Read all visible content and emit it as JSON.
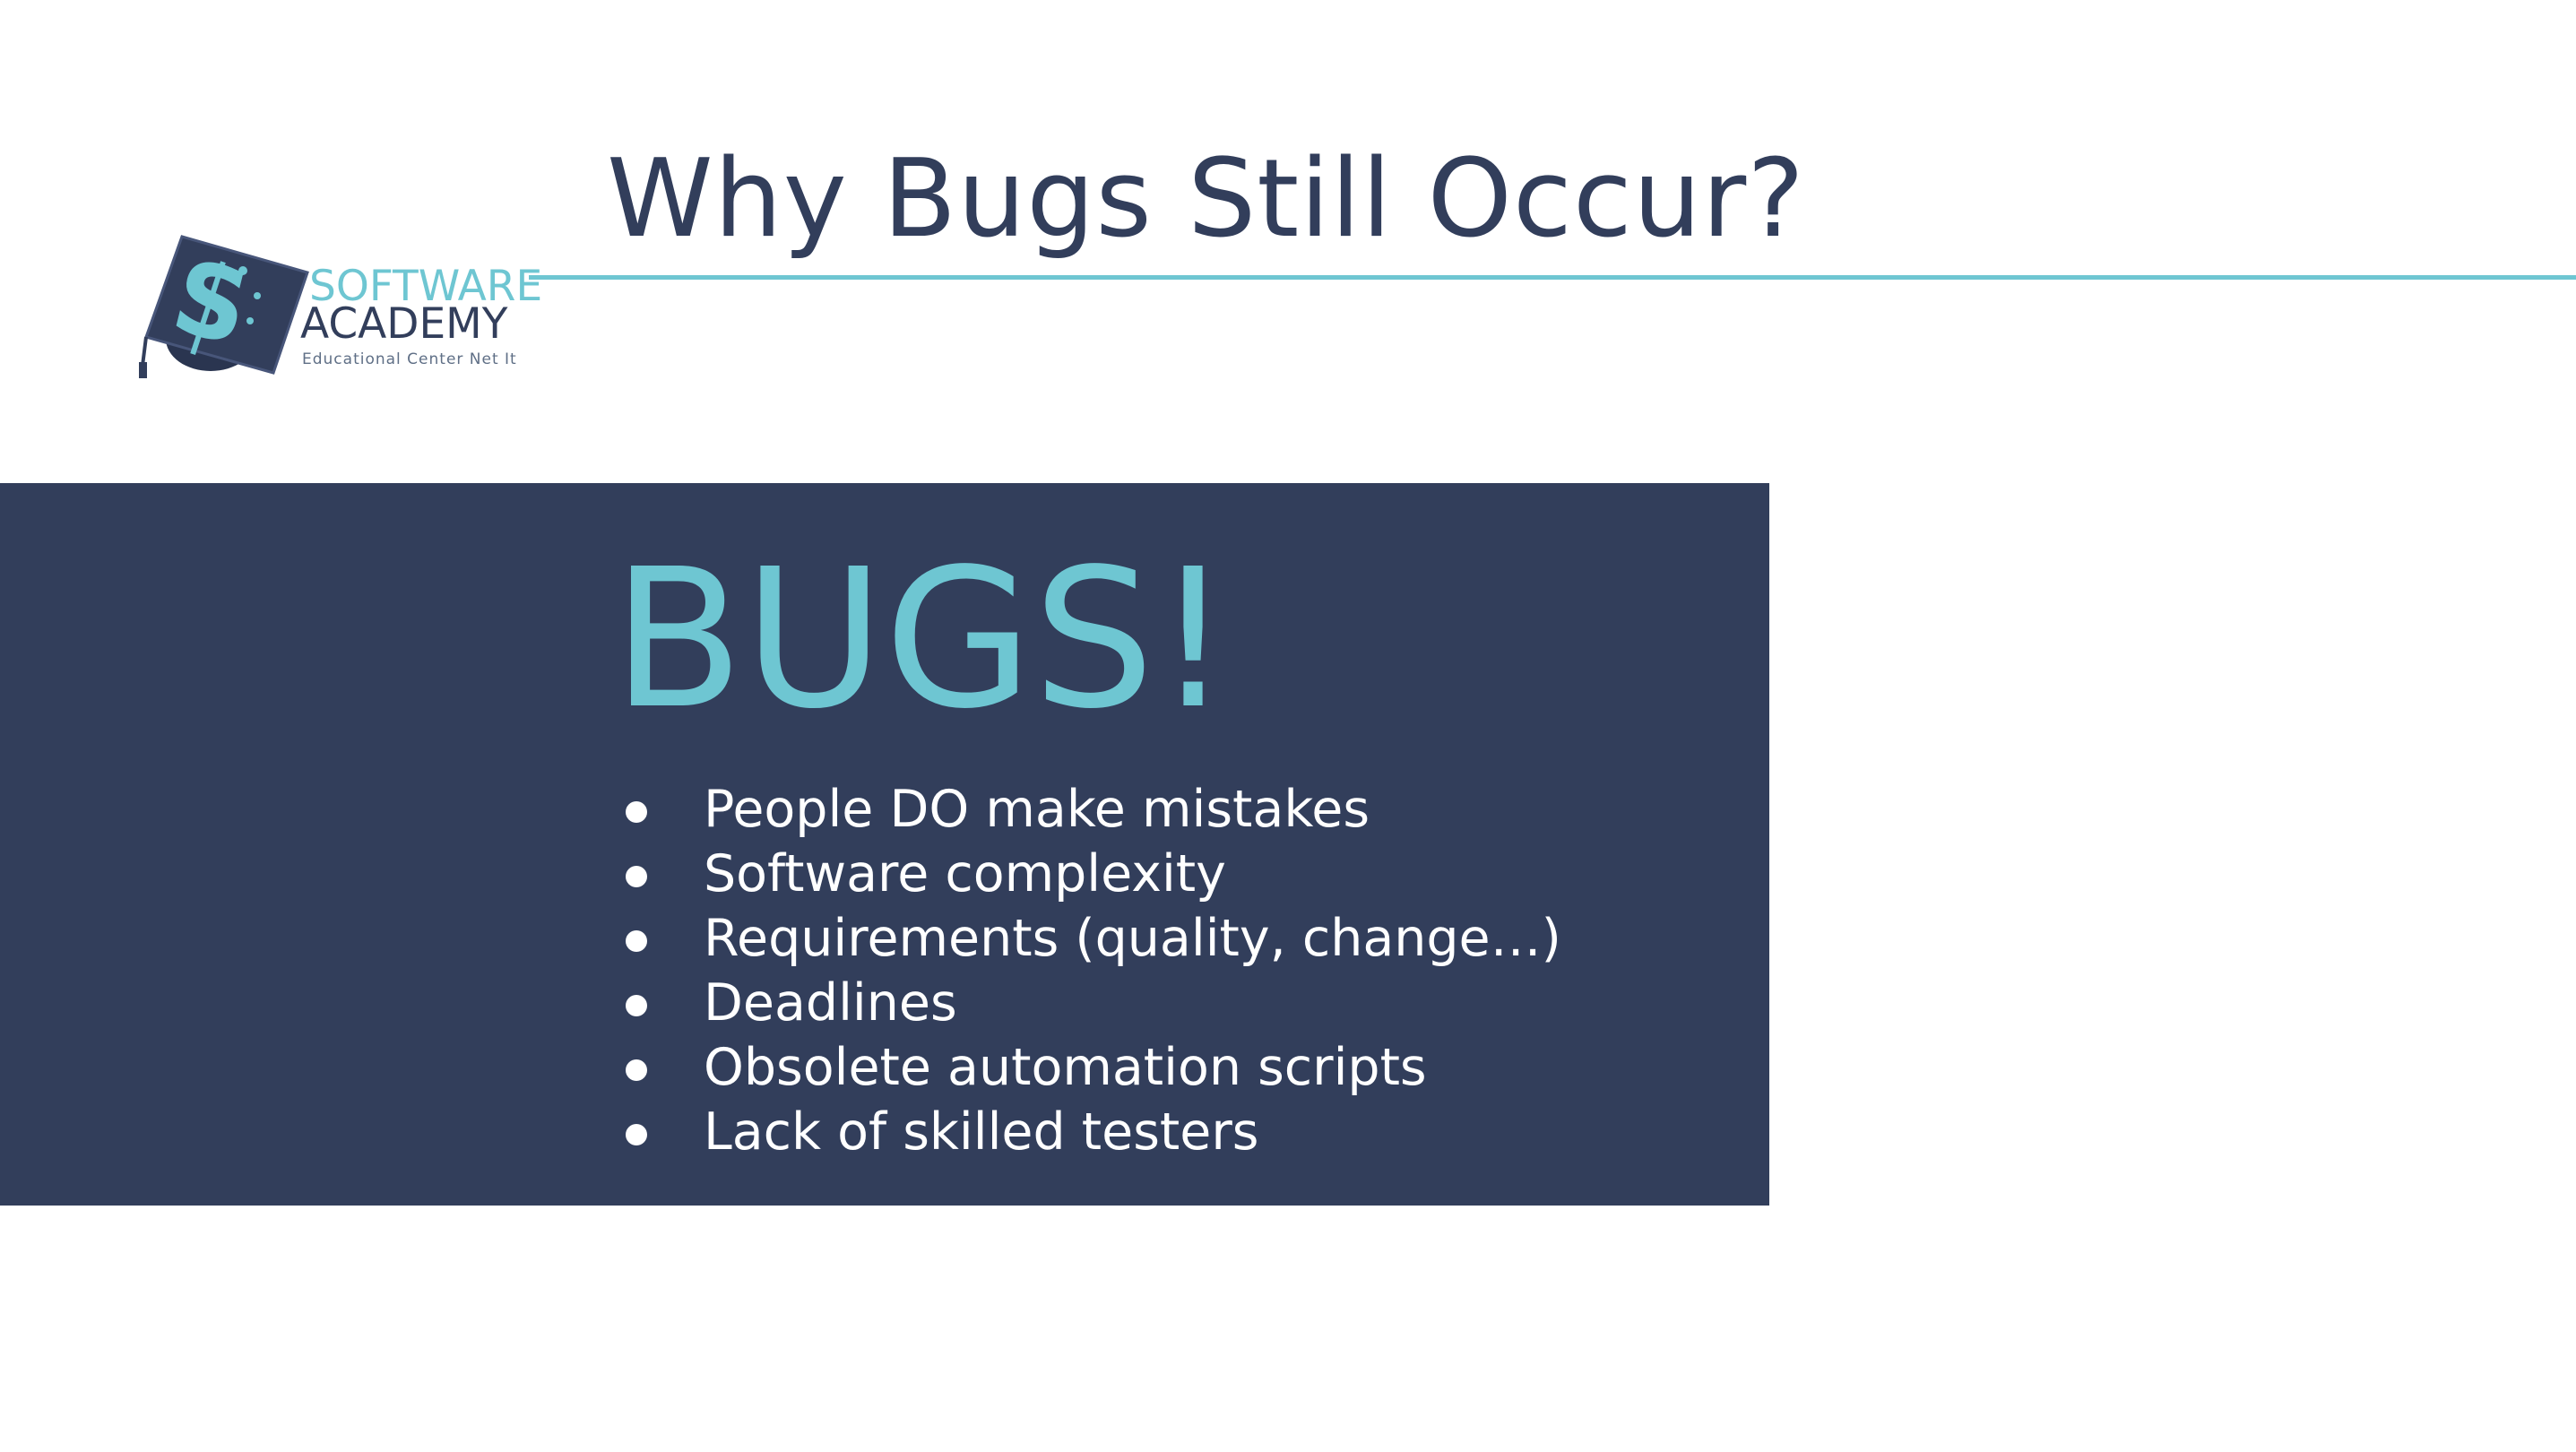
{
  "slide": {
    "title": "Why Bugs Still Occur?",
    "logo": {
      "line1": "SOFTWARE",
      "line2": "ACADEMY",
      "tagline": "Educational Center Net It",
      "icon": "graduation-cap-dollar-icon"
    },
    "panel": {
      "heading": "BUGS!",
      "bullets": [
        "People DO make mistakes",
        "Software complexity",
        "Requirements (quality, change…)",
        "Deadlines",
        "Obsolete automation scripts",
        "Lack of skilled testers"
      ]
    }
  },
  "colors": {
    "navy": "#323e5b",
    "accent": "#6ec6d2",
    "background": "#ffffff",
    "bullet_text": "#ffffff"
  }
}
